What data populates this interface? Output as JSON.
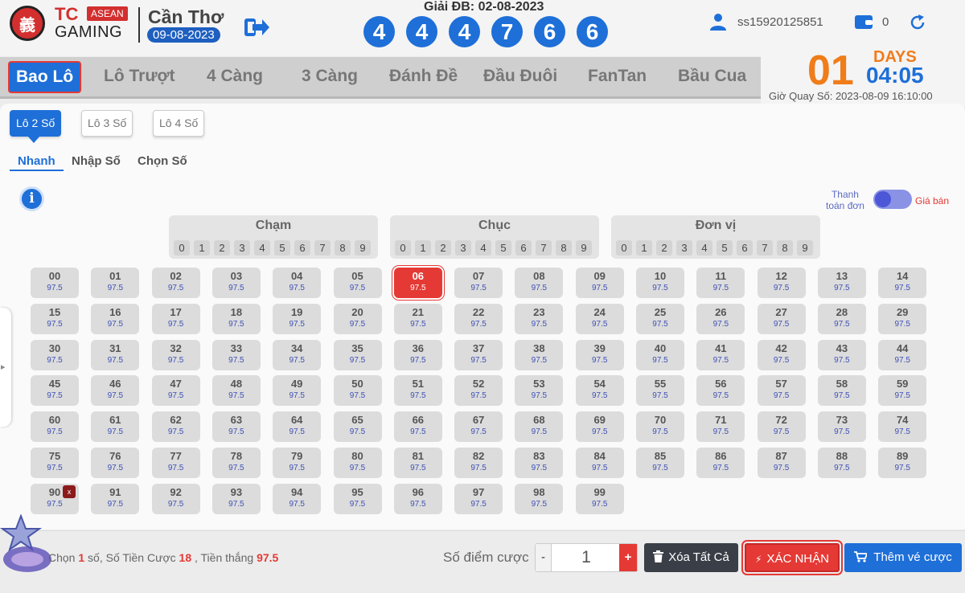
{
  "header": {
    "logo_glyph": "義",
    "logo_tc": "TC",
    "logo_asean": "ASEAN",
    "logo_gaming": "GAMING",
    "city": "Cần Thơ",
    "date": "09-08-2023",
    "special_prize_label": "Giải ĐB: 02-08-2023",
    "balls": [
      "4",
      "4",
      "4",
      "7",
      "6",
      "6"
    ],
    "username": "ss15920125851",
    "balance": "0"
  },
  "tabs": [
    "Bao Lô",
    "Lô Trượt",
    "4 Càng",
    "3 Càng",
    "Đánh Đề",
    "Đầu Đuôi",
    "FanTan",
    "Bầu Cua"
  ],
  "countdown": {
    "days_value": "01",
    "days_label": "DAYS",
    "time": "04:05",
    "draw_time": "Giờ Quay Số: 2023-08-09 16:10:00"
  },
  "subtabs": [
    "Lô 2 Số",
    "Lô 3 Số",
    "Lô 4 Số"
  ],
  "modes": [
    "Nhanh",
    "Nhập Số",
    "Chọn Số"
  ],
  "info_glyph": "i",
  "toggle": {
    "left_label_1": "Thanh",
    "left_label_2": "toán đơn",
    "right_label": "Giá bán"
  },
  "filters": [
    {
      "title": "Chạm",
      "digits": [
        "0",
        "1",
        "2",
        "3",
        "4",
        "5",
        "6",
        "7",
        "8",
        "9"
      ]
    },
    {
      "title": "Chục",
      "digits": [
        "0",
        "1",
        "2",
        "3",
        "4",
        "5",
        "6",
        "7",
        "8",
        "9"
      ]
    },
    {
      "title": "Đơn vị",
      "digits": [
        "0",
        "1",
        "2",
        "3",
        "4",
        "5",
        "6",
        "7",
        "8",
        "9"
      ]
    }
  ],
  "grid": {
    "odds": "97.5",
    "selected": [
      "06"
    ],
    "cell_badge": {
      "cell": "90",
      "glyph": "x"
    }
  },
  "footer": {
    "summary_1": "Chọn ",
    "count": "1",
    "summary_2": " số,  Số Tiền Cược ",
    "amount": "18",
    "summary_3": " ,  Tiền thắng ",
    "win": "97.5",
    "points_label": "Số điểm cược",
    "stepper_minus": "-",
    "stepper_value": "1",
    "stepper_plus": "+",
    "clear_label": "Xóa Tất Cả",
    "confirm_label": "XÁC NHẬN",
    "add_label": "Thêm vé cược"
  },
  "colors": {
    "accent": "#1e6fd8",
    "danger": "#e53935",
    "orange": "#f07c1a"
  }
}
